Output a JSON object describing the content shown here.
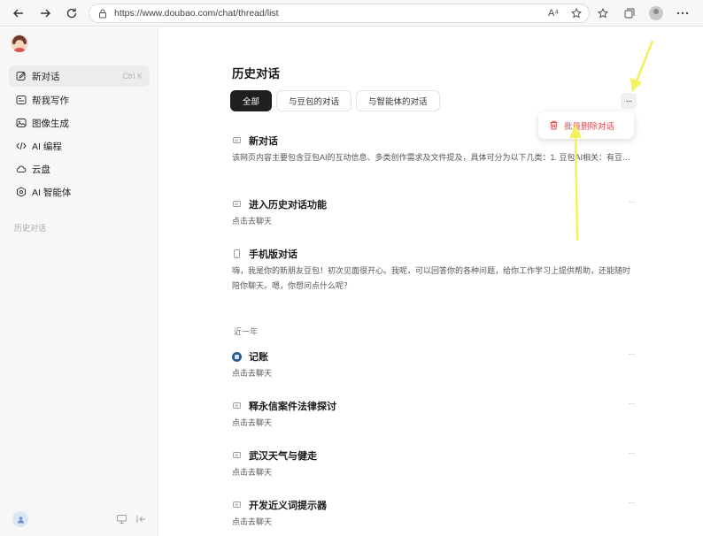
{
  "browser": {
    "url": "https://www.doubao.com/chat/thread/list",
    "reader_label": "A⁴"
  },
  "sidebar": {
    "items": [
      {
        "label": "新对话",
        "shortcut": "Ctrl K"
      },
      {
        "label": "帮我写作"
      },
      {
        "label": "图像生成"
      },
      {
        "label": "AI 编程"
      },
      {
        "label": "云盘"
      },
      {
        "label": "AI 智能体"
      }
    ],
    "section_label": "历史对话"
  },
  "main": {
    "title": "历史对话",
    "tabs": [
      {
        "label": "全部",
        "active": true
      },
      {
        "label": "与豆包的对话",
        "active": false
      },
      {
        "label": "与智能体的对话",
        "active": false
      }
    ],
    "more_button": "···",
    "menu": {
      "label": "批量删除对话"
    },
    "threads": [
      {
        "title": "新对话",
        "desc": "该网页内容主要包含豆包AI的互动信息、多类创作需求及文件提及，具体可分为以下几类：1. 豆包AI相关：有豆包的问候语\"你好，我是豆包。让我们一起度过美好的一天！\"，还涉及豆包AI生成图片的风格描述，如\"中国风\"（纯..."
      },
      {
        "title": "进入历史对话功能",
        "desc": "点击去聊天"
      },
      {
        "title": "手机版对话",
        "desc": "嗨，我是你的新朋友豆包！初次见面很开心。我呢，可以回答你的各种问题，给你工作学习上提供帮助，还能随时陪你聊天。嗯，你想问点什么呢？"
      }
    ],
    "group_label": "近一年",
    "older_threads": [
      {
        "title": "记账",
        "desc": "点击去聊天"
      },
      {
        "title": "释永信案件法律探讨",
        "desc": "点击去聊天"
      },
      {
        "title": "武汉天气与健走",
        "desc": "点击去聊天"
      },
      {
        "title": "开发近义词提示器",
        "desc": "点击去聊天"
      }
    ],
    "row_dots": "···"
  },
  "colors": {
    "accent_dark": "#1f1f1f",
    "danger": "#e5484d",
    "annotation": "#f2f25a"
  }
}
